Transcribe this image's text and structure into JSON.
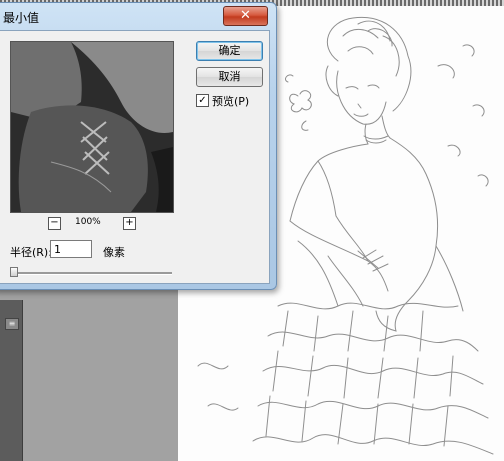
{
  "dialog": {
    "title": "最小值",
    "title_visible": "最小值",
    "close_label": "✕",
    "zoom_out_label": "−",
    "zoom_level": "100%",
    "zoom_in_label": "+",
    "radius_label": "半径(R):",
    "radius_value": "1",
    "radius_unit": "像素",
    "ok_label": "确定",
    "cancel_label": "取消",
    "preview_label": "预览(P)",
    "preview_checked": true,
    "slider_position": 0
  },
  "panel": {
    "menu_icon": "panel-menu-icon"
  },
  "colors": {
    "workspace": "#a2a2a2",
    "dialog_frame": "#b9d3ec",
    "close_red": "#c23b1f"
  }
}
